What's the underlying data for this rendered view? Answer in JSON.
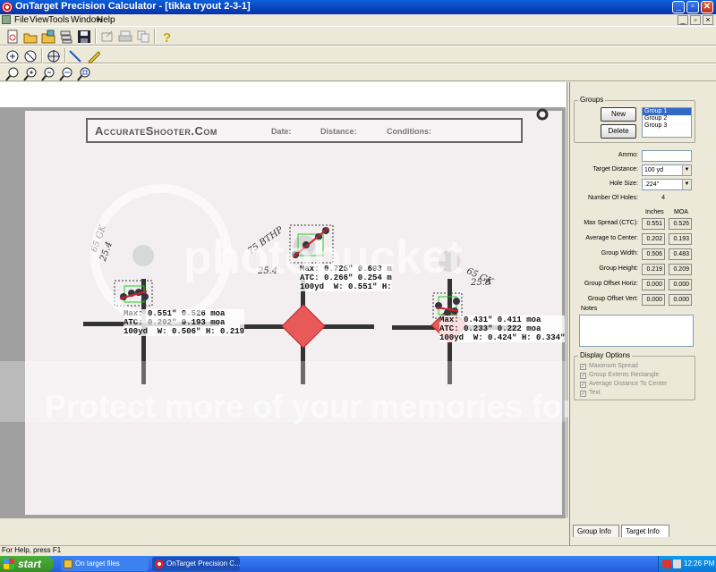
{
  "window": {
    "title": "OnTarget Precision Calculator - [tikka tryout 2-3-1]"
  },
  "menu": {
    "items": [
      "File",
      "View",
      "Tools",
      "Window",
      "Help"
    ]
  },
  "target": {
    "brand": "AccurateShooter.Com",
    "fields": [
      "Date:",
      "Distance:",
      "Conditions:"
    ],
    "watermark_lines": [
      "Protect more of your memories for less!",
      "photobucket"
    ],
    "handwriting": [
      {
        "lines": [
          "65 GK",
          "25.4"
        ]
      },
      {
        "lines": [
          "75 BTHP",
          "25.4"
        ]
      },
      {
        "lines": [
          "65 GK",
          "25.8"
        ]
      }
    ],
    "groups": [
      {
        "line1": "Max: 0.551\" 0.526 moa",
        "line2": "ATC: 0.202\" 0.193 moa",
        "line3": "100yd  W: 0.506\" H: 0.219"
      },
      {
        "line1": "Max: 0.725\" 0.693 m",
        "line2": "ATC: 0.266\" 0.254 m",
        "line3": "100yd  W: 0.551\" H:"
      },
      {
        "line1": "Max: 0.431\" 0.411 moa",
        "line2": "ATC: 0.233\" 0.222 moa",
        "line3": "100yd  W: 0.424\" H: 0.334\""
      }
    ]
  },
  "panel": {
    "groups_legend": "Groups",
    "new_button": "New",
    "delete_button": "Delete",
    "group_list": [
      "Group 1",
      "Group 2",
      "Group 3"
    ],
    "selected_group": "Group 1",
    "ammo_label": "Ammo:",
    "ammo_value": "",
    "target_distance_label": "Target Distance:",
    "target_distance_value": "100 yd",
    "hole_size_label": "Hole Size:",
    "hole_size_value": ".224\"",
    "num_holes_label": "Number Of Holes:",
    "num_holes_value": "4",
    "col_inches": "Inches",
    "col_moa": "MOA",
    "stats": [
      {
        "label": "Max Spread (CTC):",
        "inches": "0.551",
        "moa": "0.526"
      },
      {
        "label": "Average to Center:",
        "inches": "0.202",
        "moa": "0.193"
      },
      {
        "label": "Group Width:",
        "inches": "0.506",
        "moa": "0.483"
      },
      {
        "label": "Group Height:",
        "inches": "0.219",
        "moa": "0.209"
      },
      {
        "label": "Group Offset Horiz:",
        "inches": "0.000",
        "moa": "0.000"
      },
      {
        "label": "Group Offset Vert:",
        "inches": "0.000",
        "moa": "0.000"
      }
    ],
    "notes_label": "Notes",
    "notes_value": "",
    "display_options_legend": "Display Options",
    "display_options": [
      "Maximum Spread",
      "Group Extents Rectangle",
      "Average Distance To Center",
      "Text"
    ],
    "tabs": [
      "Group Info",
      "Target Info"
    ]
  },
  "status": {
    "text": "For Help, press F1"
  },
  "taskbar": {
    "start": "start",
    "tasks": [
      "On target files",
      "OnTarget Precision C..."
    ],
    "clock": "12:26 PM"
  }
}
